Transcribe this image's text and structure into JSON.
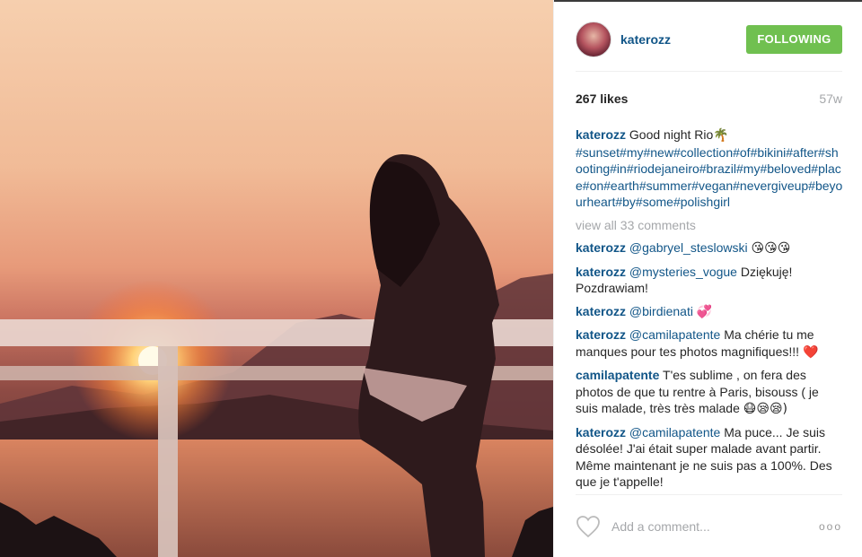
{
  "post": {
    "username": "katerozz",
    "follow_label": "FOLLOWING",
    "likes": "267 likes",
    "time_ago": "57w",
    "caption": {
      "user": "katerozz",
      "text": "Good night Rio",
      "emoji": "🌴",
      "hashtags": "#sunset#my#new#collection#of#bikini#after#shooting#in#riodejaneiro#brazil#my#beloved#place#on#earth#summer#vegan#nevergiveup#beyourheart#by#some#polishgirl"
    },
    "view_all": "view all 33 comments",
    "comments": [
      {
        "user": "katerozz",
        "mention": "@gabryel_steslowski",
        "text": "",
        "emoji": "😘😘😘"
      },
      {
        "user": "katerozz",
        "mention": "@mysteries_vogue",
        "text": "Dziękuję! Pozdrawiam!",
        "emoji": ""
      },
      {
        "user": "katerozz",
        "mention": "@birdienati",
        "text": "",
        "emoji": "💞"
      },
      {
        "user": "katerozz",
        "mention": "@camilapatente",
        "text": "Ma chérie tu me manques pour tes photos magnifiques!!!",
        "emoji": "❤️"
      },
      {
        "user": "camilapatente",
        "mention": "",
        "text": "T'es sublime , on fera des photos de que tu rentre à Paris, bisouss ( je suis malade, très très malade",
        "emoji": "😷😪😪)"
      },
      {
        "user": "katerozz",
        "mention": "@camilapatente",
        "text": "Ma puce... Je suis désolée! J'ai était super malade avant partir. Même maintenant je ne suis pas a 100%. Des que je t'appelle!",
        "emoji": ""
      }
    ],
    "add_comment_placeholder": "Add a comment...",
    "more_label": "ooo"
  },
  "colors": {
    "link": "#125688",
    "follow_button": "#70c050",
    "muted": "#a5a7aa"
  },
  "icons": {
    "like": "heart-outline-icon",
    "more": "more-options-icon"
  }
}
